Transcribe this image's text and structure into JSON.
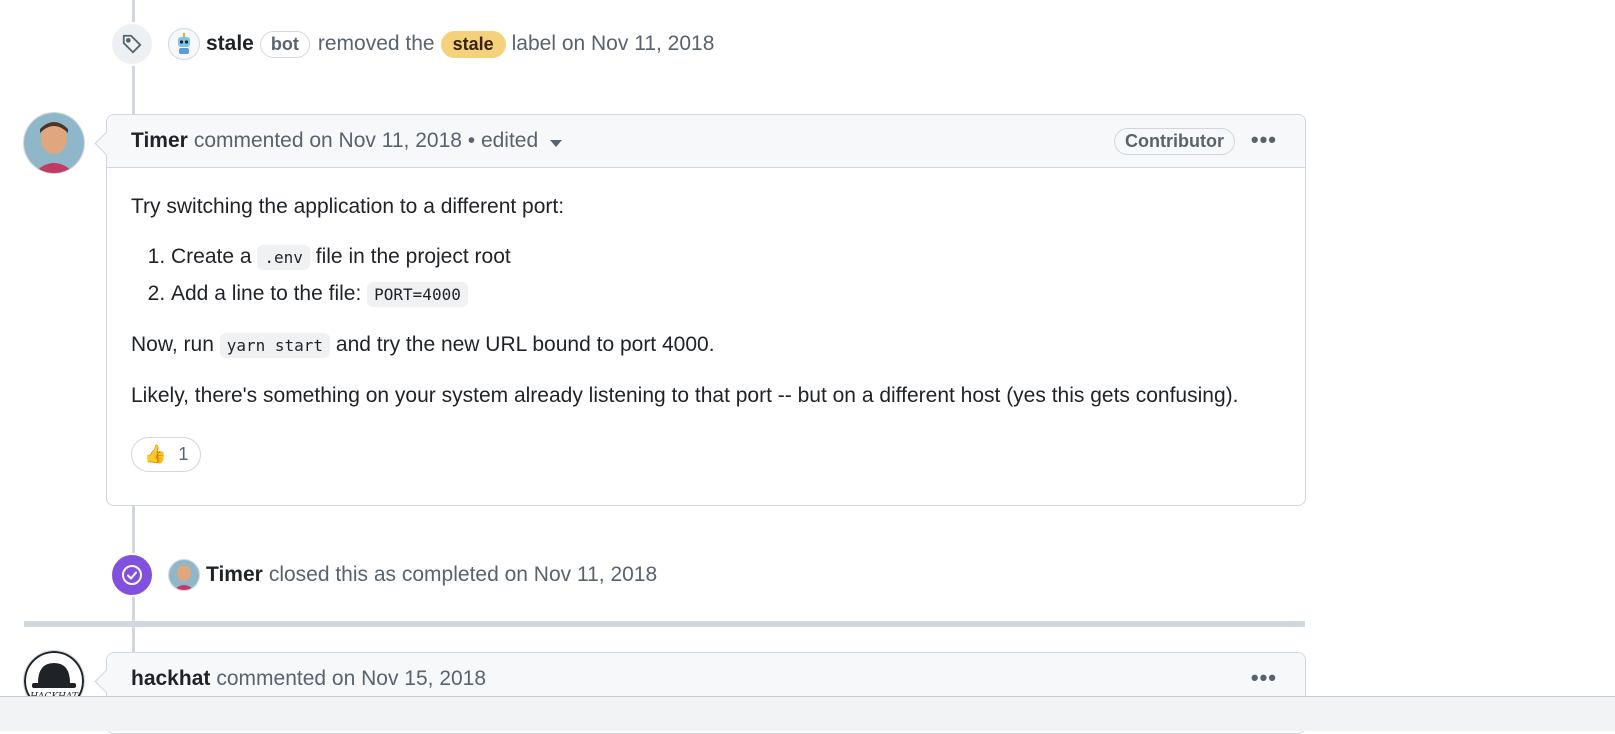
{
  "label_event": {
    "actor": "stale",
    "bot_badge": "bot",
    "action_pre": "removed the",
    "label": "stale",
    "action_post": "label on Nov 11, 2018"
  },
  "comment1": {
    "author": "Timer",
    "meta": "commented on Nov 11, 2018 • edited",
    "role_badge": "Contributor",
    "menu": "•••",
    "intro": "Try switching the application to a different port:",
    "step1_pre": "Create a",
    "step1_code": ".env",
    "step1_post": "file in the project root",
    "step2_pre": "Add a line to the file:",
    "step2_code": "PORT=4000",
    "run_pre": "Now, run",
    "run_code": "yarn start",
    "run_post": "and try the new URL bound to port 4000.",
    "likely": "Likely, there's something on your system already listening to that port -- but on a different host (yes this gets confusing).",
    "reaction_emoji": "👍",
    "reaction_count": "1"
  },
  "close_event": {
    "actor": "Timer",
    "action": "closed this as completed on Nov 11, 2018"
  },
  "comment2": {
    "author": "hackhat",
    "meta": "commented on Nov 15, 2018",
    "menu": "•••",
    "avatar_text": "HACKHAT"
  },
  "colors": {
    "stale_label": "#f4d27b",
    "closed_badge": "#8250df",
    "border": "#d0d7de"
  }
}
